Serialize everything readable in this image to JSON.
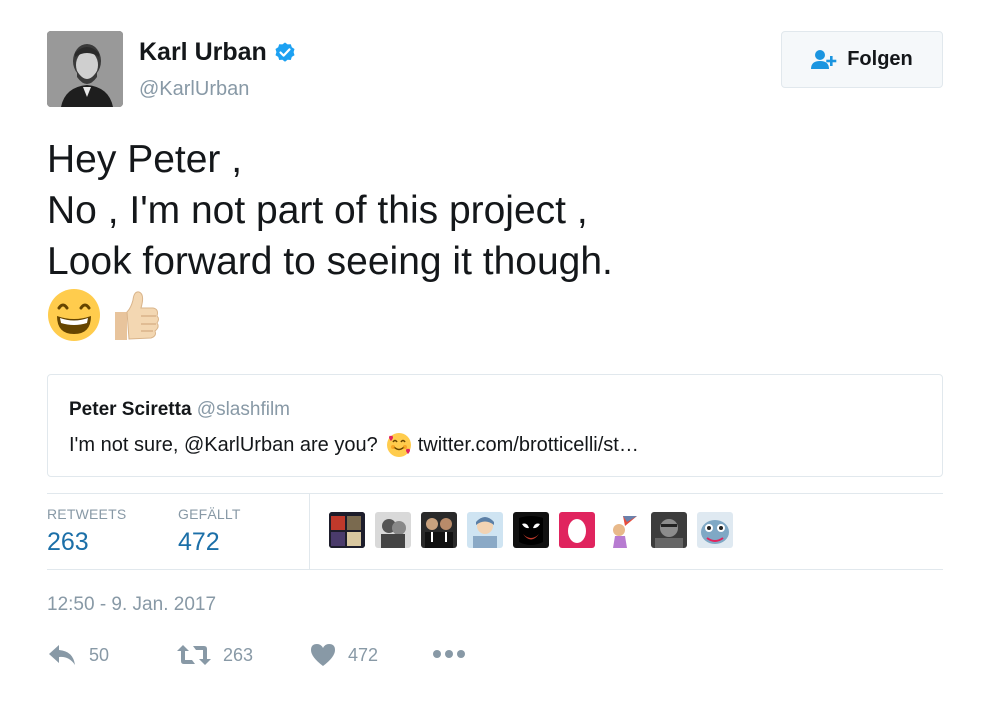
{
  "user": {
    "name": "Karl Urban",
    "handle": "@KarlUrban",
    "verified": true
  },
  "follow_button": {
    "label": "Folgen",
    "icon": "add-user-icon"
  },
  "tweet": {
    "lines": [
      "Hey Peter ,",
      "No , I'm not part of this project ,",
      "Look forward to seeing it though."
    ],
    "emojis": [
      "grinning-face-smiling-eyes",
      "thumbs-up-light-skin"
    ]
  },
  "quoted_tweet": {
    "name": "Peter Sciretta",
    "handle": "@slashfilm",
    "text_before": "I'm not sure, @KarlUrban are you?",
    "emoji": "smiling-face-hearts",
    "link": "twitter.com/brotticelli/st…"
  },
  "stats": {
    "retweets_label": "RETWEETS",
    "retweets": "263",
    "likes_label": "GEFÄLLT",
    "likes": "472"
  },
  "likers": [
    "avatar-1",
    "avatar-2",
    "avatar-3",
    "avatar-4",
    "avatar-5",
    "avatar-6",
    "avatar-7",
    "avatar-8",
    "avatar-9"
  ],
  "timestamp": "12:50 - 9. Jan. 2017",
  "actions": {
    "reply_count": "50",
    "retweet_count": "263",
    "like_count": "472"
  },
  "colors": {
    "link_blue": "#1b6fa8",
    "verified_blue": "#1da1f2",
    "muted_gray": "#8899a6",
    "border": "#e1e8ed"
  }
}
